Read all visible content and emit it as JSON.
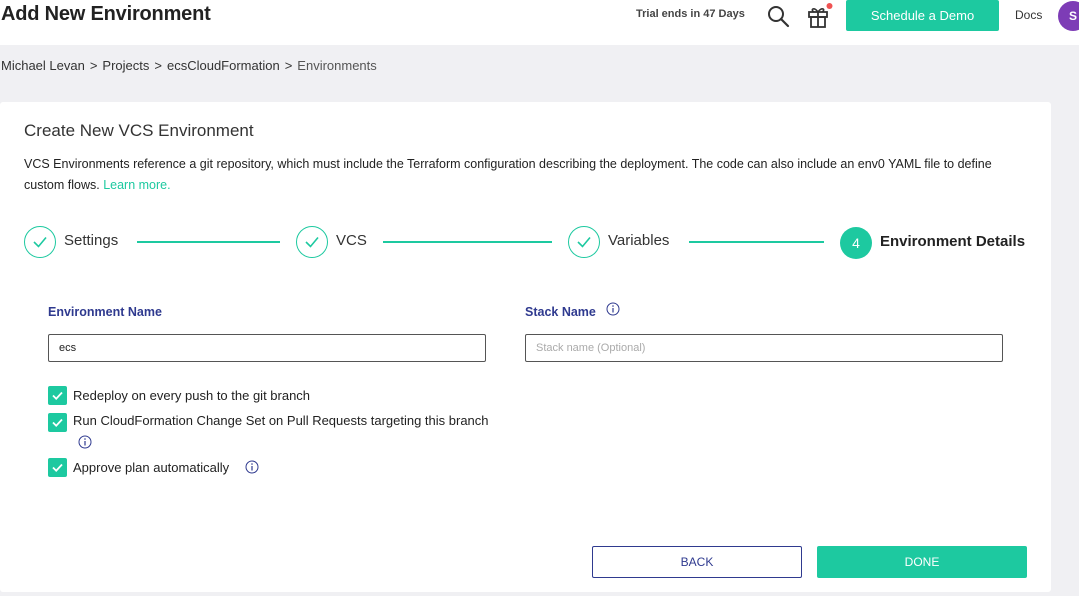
{
  "header": {
    "page_title": "Add New Environment",
    "trial_text": "Trial ends in 47 Days",
    "schedule_demo_label": "Schedule a Demo",
    "docs_label": "Docs",
    "avatar_initial": "S",
    "search_icon": "search-icon",
    "gift_icon": "gift-icon",
    "notification_dot_color": "#f05252"
  },
  "breadcrumb": {
    "items": [
      "Michael Levan",
      "Projects",
      "ecsCloudFormation",
      "Environments"
    ],
    "separator": ">"
  },
  "card": {
    "title": "Create New VCS Environment",
    "description_line1": "VCS Environments reference a git repository, which must include the Terraform configuration describing the deployment. The code can also include an env0 YAML file to define",
    "description_line2": "custom flows.",
    "learn_more_label": "Learn more."
  },
  "stepper": {
    "steps": [
      {
        "label": "Settings",
        "state": "completed"
      },
      {
        "label": "VCS",
        "state": "completed"
      },
      {
        "label": "Variables",
        "state": "completed"
      },
      {
        "label": "Environment Details",
        "state": "active",
        "number": "4"
      }
    ]
  },
  "form": {
    "environment_name": {
      "label": "Environment Name",
      "value": "ecs"
    },
    "stack_name": {
      "label": "Stack Name",
      "placeholder": "Stack name (Optional)",
      "value": ""
    },
    "checkboxes": [
      {
        "label": "Redeploy on every push to the git branch",
        "checked": true
      },
      {
        "label": "Run CloudFormation Change Set on Pull Requests targeting this branch",
        "checked": true
      },
      {
        "label": "Approve plan automatically",
        "checked": true
      }
    ]
  },
  "actions": {
    "back_label": "BACK",
    "done_label": "DONE"
  },
  "colors": {
    "accent": "#1dc9a0",
    "label_blue": "#2f3a8f",
    "avatar_purple": "#7d3cb6"
  }
}
